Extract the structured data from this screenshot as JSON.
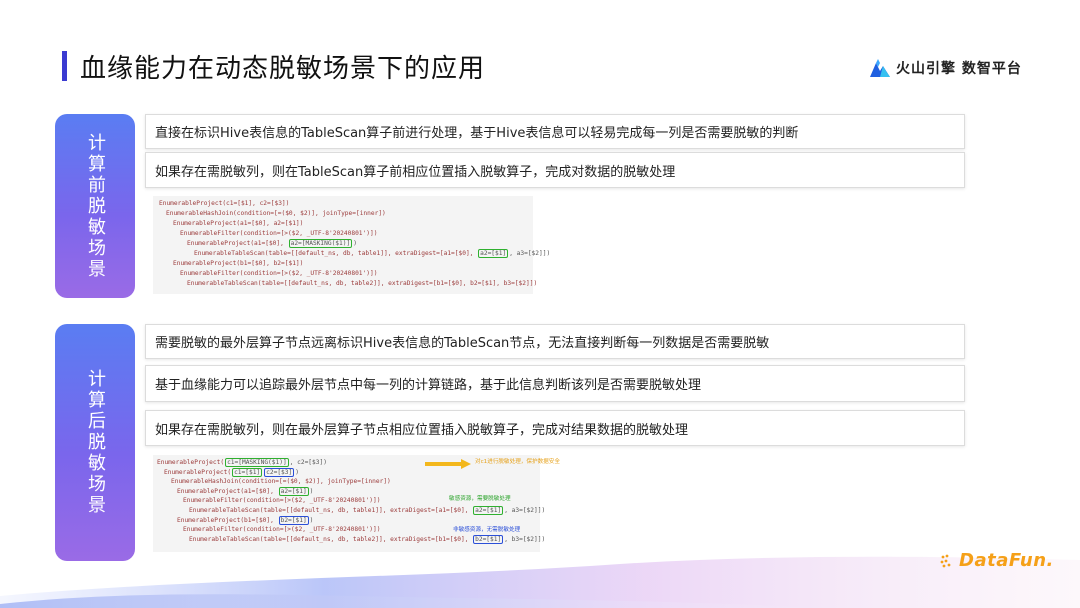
{
  "header": {
    "title": "血缘能力在动态脱敏场景下的应用",
    "brand": "火山引擎 数智平台",
    "accent": "#3b3bd1"
  },
  "section1": {
    "label": "计算前脱敏场景",
    "rows": [
      "直接在标识Hive表信息的TableScan算子前进行处理，基于Hive表信息可以轻易完成每一列是否需要脱敏的判断",
      "如果存在需脱敏列，则在TableScan算子前相应位置插入脱敏算子，完成对数据的脱敏处理"
    ],
    "code": {
      "l1": "EnumerableProject(c1=[$1], c2=[$3])",
      "l2": "EnumerableHashJoin(condition=[=($0, $2)], joinType=[inner])",
      "l3": "EnumerableProject(a1=[$0], a2=[$1])",
      "l4": "EnumerableFilter(condition=[>($2, _UTF-8'20240801')])",
      "l5a": "EnumerableProject(a1=[$0], ",
      "l5b": "a2=[MASKING($1)]",
      "l5c": ")",
      "l6a": "EnumerableTableScan(table=[[default_ns, db, table1]], extraDigest=[a1=[$0], ",
      "l6b": "a2=[$1]",
      "l6c": ", a3=[$2]])",
      "l7": "EnumerableProject(b1=[$0], b2=[$1])",
      "l8": "EnumerableFilter(condition=[>($2, _UTF-8'20240801')])",
      "l9": "EnumerableTableScan(table=[[default_ns, db, table2]], extraDigest=[b1=[$0], b2=[$1], b3=[$2]])"
    }
  },
  "section2": {
    "label": "计算后脱敏场景",
    "rows": [
      "需要脱敏的最外层算子节点远离标识Hive表信息的TableScan节点，无法直接判断每一列数据是否需要脱敏",
      "基于血缘能力可以追踪最外层节点中每一列的计算链路，基于此信息判断该列是否需要脱敏处理",
      "如果存在需脱敏列，则在最外层算子节点相应位置插入脱敏算子，完成对结果数据的脱敏处理"
    ],
    "code": {
      "l1a": "EnumerableProject(",
      "l1b": "c1=[MASKING($1)]",
      "l1c": ", c2=[$3])",
      "l2a": "EnumerableProject(",
      "l2b": "c1=[$1]",
      "l2c": "c2=[$3]",
      "l2d": ")",
      "l3": "EnumerableHashJoin(condition=[=($0, $2)], joinType=[inner])",
      "l4a": "EnumerableProject(a1=[$0], ",
      "l4b": "a2=[$1]",
      "l4c": ")",
      "l5": "EnumerableFilter(condition=[>($2, _UTF-8'20240801')])",
      "l6a": "EnumerableTableScan(table=[[default_ns, db, table1]], extraDigest=[a1=[$0], ",
      "l6b": "a2=[$1]",
      "l6c": ", a3=[$2]])",
      "l7a": "EnumerableProject(b1=[$0], ",
      "l7b": "b2=[$1]",
      "l7c": ")",
      "l8": "EnumerableFilter(condition=[>($2, _UTF-8'20240801')])",
      "l9a": "EnumerableTableScan(table=[[default_ns, db, table2]], extraDigest=[b1=[$0], ",
      "l9b": "b2=[$1]",
      "l9c": ", b3=[$2]])",
      "note_orange": "对c1进行脱敏处理，保护数据安全",
      "note_green": "敏感资源，需要脱敏处理",
      "note_blue": "非敏感资源，无需脱敏处理"
    }
  },
  "footer": {
    "logo_text": "DataFun."
  },
  "colors": {
    "side_gradient_top": "#5a7df2",
    "side_gradient_bottom": "#9a6be6",
    "highlight_green": "#2fb02f",
    "highlight_blue": "#2b4fd8",
    "annotation_orange": "#e6a21c",
    "logo_orange": "#f5a018"
  }
}
